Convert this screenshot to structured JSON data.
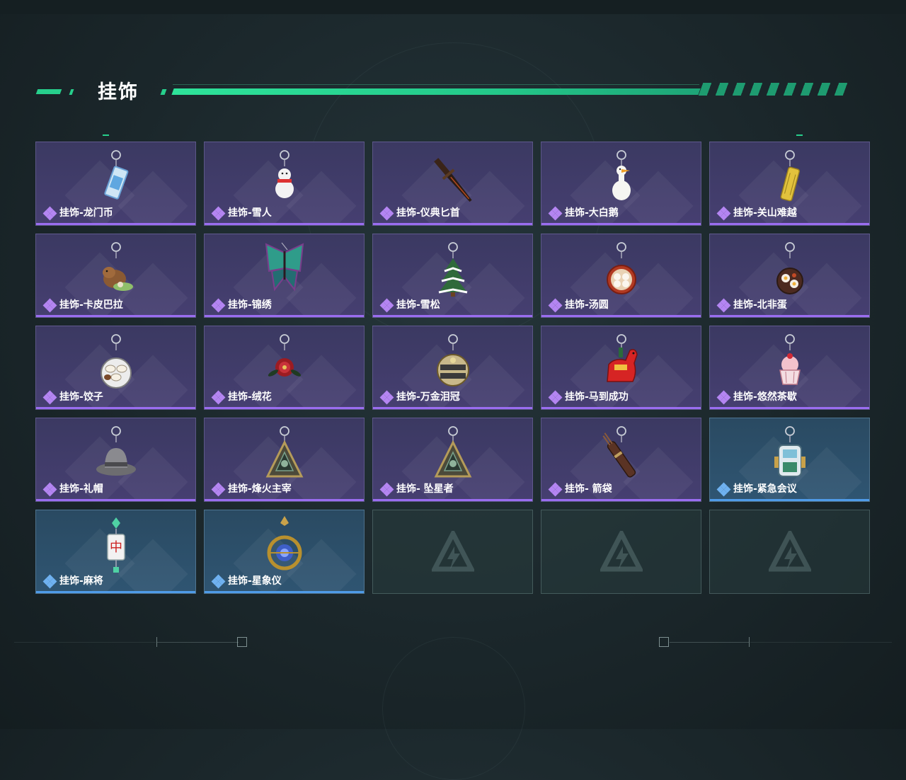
{
  "header": {
    "title": "挂饰"
  },
  "colors": {
    "accent": "#27cf8c",
    "purple_rarity": "#9a6df0",
    "blue_rarity": "#4f9be8"
  },
  "items": [
    {
      "label": "挂饰-龙门币",
      "rarity": "purple",
      "icon": "card-icon"
    },
    {
      "label": "挂饰-雪人",
      "rarity": "purple",
      "icon": "snowman-icon"
    },
    {
      "label": "挂饰-仪典匕首",
      "rarity": "purple",
      "icon": "dagger-icon"
    },
    {
      "label": "挂饰-大白鹅",
      "rarity": "purple",
      "icon": "goose-icon"
    },
    {
      "label": "挂饰-关山难越",
      "rarity": "purple",
      "icon": "scroll-icon"
    },
    {
      "label": "挂饰-卡皮巴拉",
      "rarity": "purple",
      "icon": "capybara-icon"
    },
    {
      "label": "挂饰-锦绣",
      "rarity": "purple",
      "icon": "butterfly-icon"
    },
    {
      "label": "挂饰-雪松",
      "rarity": "purple",
      "icon": "tree-icon"
    },
    {
      "label": "挂饰-汤圆",
      "rarity": "purple",
      "icon": "bowl-icon"
    },
    {
      "label": "挂饰-北非蛋",
      "rarity": "purple",
      "icon": "pan-icon"
    },
    {
      "label": "挂饰-饺子",
      "rarity": "purple",
      "icon": "dumpling-icon"
    },
    {
      "label": "挂饰-绒花",
      "rarity": "purple",
      "icon": "flower-icon"
    },
    {
      "label": "挂饰-万金泪冠",
      "rarity": "purple",
      "icon": "crown-icon"
    },
    {
      "label": "挂饰-马到成功",
      "rarity": "purple",
      "icon": "horse-icon"
    },
    {
      "label": "挂饰-悠然茶歇",
      "rarity": "purple",
      "icon": "cake-icon"
    },
    {
      "label": "挂饰-礼帽",
      "rarity": "purple",
      "icon": "hat-icon"
    },
    {
      "label": "挂饰-烽火主宰",
      "rarity": "purple",
      "icon": "triangle-icon"
    },
    {
      "label": "挂饰- 坠星者",
      "rarity": "purple",
      "icon": "triangle-icon"
    },
    {
      "label": "挂饰- 箭袋",
      "rarity": "purple",
      "icon": "quiver-icon"
    },
    {
      "label": "挂饰-紧急会议",
      "rarity": "blue",
      "icon": "robot-icon"
    },
    {
      "label": "挂饰-麻将",
      "rarity": "blue",
      "icon": "mahjong-icon"
    },
    {
      "label": "挂饰-星象仪",
      "rarity": "blue",
      "icon": "astrolabe-icon"
    }
  ],
  "empty_slots": 3
}
